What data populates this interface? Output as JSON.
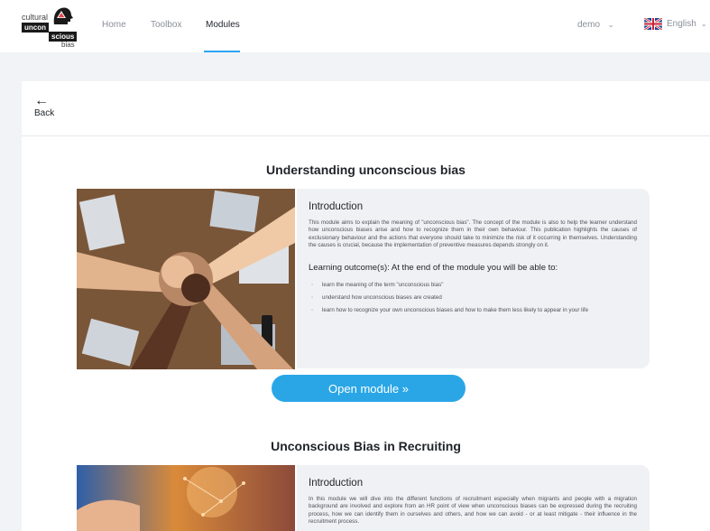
{
  "logo": {
    "line1": "cultural",
    "line2": "uncon",
    "line3": "scious",
    "line4": "bias"
  },
  "nav": {
    "home": "Home",
    "toolbox": "Toolbox",
    "modules": "Modules"
  },
  "user": {
    "name": "demo"
  },
  "language": {
    "label": "English"
  },
  "back": {
    "label": "Back"
  },
  "modules": [
    {
      "title": "Understanding unconscious bias",
      "intro_heading": "Introduction",
      "intro_text": "This module aims to explain the meaning of \"unconscious bias\". The concept of the module is also to help the learner understand how unconscious biases arise and how to recognize them in their own behaviour. This publication highlights the causes of exclusionary behaviour and the actions that everyone should take to minimize the risk of it occurring in themselves. Understanding the causes is crucial, because the implementation of preventive measures depends strongly on it.",
      "outcome_heading": "Learning outcome(s): At the end of the module you will be able to:",
      "outcomes": [
        "learn the meaning of the term \"unconscious bias\"",
        "understand how unconscious biases are created",
        "learn how to recognize your own unconscious biases and how to make them less likely to appear in your life"
      ],
      "button_label": "Open module »"
    },
    {
      "title": "Unconscious Bias in Recruiting",
      "intro_heading": "Introduction",
      "intro_text": "In this module we will dive into the different functions of recruitment especially when migrants and people with a migration background are involved and explore from an HR point of view when unconscious biases can be expressed during the recruiting process, how we can identify them in ourselves and others, and how we can avoid - or at least mitigate - their influence in the recruitment process."
    }
  ],
  "colors": {
    "accent": "#2aa6e6",
    "panel": "#f0f1f4",
    "background": "#f2f3f6"
  }
}
